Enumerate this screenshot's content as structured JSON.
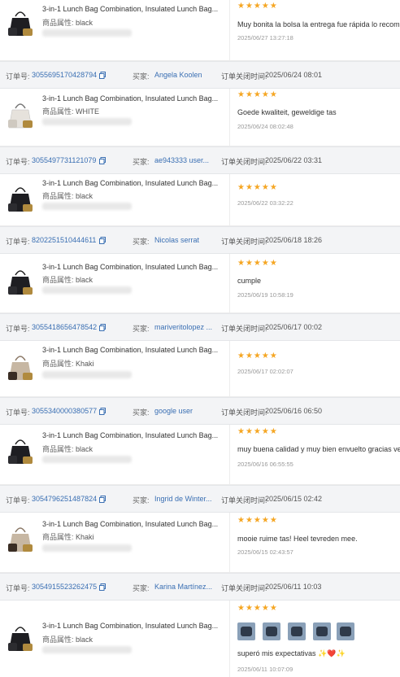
{
  "labels": {
    "order_no": "订单号:",
    "buyer": "买家:",
    "closed_time": "订单关闭时间:",
    "attr": "商品属性:"
  },
  "colors": {
    "header_bg": "#f3f4f6",
    "link": "#3a6fb3",
    "star": "#f5a623",
    "time": "#999999"
  },
  "icons": {
    "copy": "copy-icon",
    "star": "star-icon",
    "product": "lunch-bag-thumbnail"
  },
  "top_partial": {
    "product_title": "3-in-1 Lunch Bag Combination, Insulated Lunch Bag...",
    "attr_value": "black",
    "stars": "★★★★★",
    "review_text": "Muy bonita la bolsa la entrega fue rápida lo recomiendo",
    "review_time": "2025/06/27 13:27:18"
  },
  "orders": [
    {
      "order_id": "3055695170428794",
      "buyer": "Angela Koolen",
      "closed_at": "2025/06/24 08:01",
      "product_title": "3-in-1 Lunch Bag Combination, Insulated Lunch Bag...",
      "attr_value": "WHITE",
      "stars": "★★★★★",
      "review_text": "Goede kwaliteit, geweldige tas",
      "review_time": "2025/06/24 08:02:48"
    },
    {
      "order_id": "3055497731121079",
      "buyer": "ae943333 user...",
      "closed_at": "2025/06/22 03:31",
      "product_title": "3-in-1 Lunch Bag Combination, Insulated Lunch Bag...",
      "attr_value": "black",
      "stars": "★★★★★",
      "review_text": "",
      "review_time": "2025/06/22 03:32:22"
    },
    {
      "order_id": "8202251510444611",
      "buyer": "Nicolas serrat",
      "closed_at": "2025/06/18 18:26",
      "product_title": "3-in-1 Lunch Bag Combination, Insulated Lunch Bag...",
      "attr_value": "black",
      "stars": "★★★★★",
      "review_text": "cumple",
      "review_time": "2025/06/19 10:58:19"
    },
    {
      "order_id": "3055418656478542",
      "buyer": "mariveritolopez ...",
      "closed_at": "2025/06/17 00:02",
      "product_title": "3-in-1 Lunch Bag Combination, Insulated Lunch Bag...",
      "attr_value": "Khaki",
      "stars": "★★★★★",
      "review_text": "",
      "review_time": "2025/06/17 02:02:07"
    },
    {
      "order_id": "3055340000380577",
      "buyer": "google user",
      "closed_at": "2025/06/16 06:50",
      "product_title": "3-in-1 Lunch Bag Combination, Insulated Lunch Bag...",
      "attr_value": "black",
      "stars": "★★★★★",
      "review_text": "muy buena calidad y muy bien envuelto gracias vendedor",
      "review_time": "2025/06/16 06:55:55"
    },
    {
      "order_id": "3054796251487824",
      "buyer": "Ingrid de Winter...",
      "closed_at": "2025/06/15 02:42",
      "product_title": "3-in-1 Lunch Bag Combination, Insulated Lunch Bag...",
      "attr_value": "Khaki",
      "stars": "★★★★★",
      "review_text": "mooie ruime tas! Heel tevreden mee.",
      "review_time": "2025/06/15 02:43:57"
    },
    {
      "order_id": "3054915523262475",
      "buyer": "Karina Martínez...",
      "closed_at": "2025/06/11 10:03",
      "product_title": "3-in-1 Lunch Bag Combination, Insulated Lunch Bag...",
      "attr_value": "black",
      "stars": "★★★★★",
      "review_text": "superó mis expectativas",
      "review_emojis": "✨❤️✨",
      "review_time": "2025/06/11 10:07:09"
    }
  ]
}
